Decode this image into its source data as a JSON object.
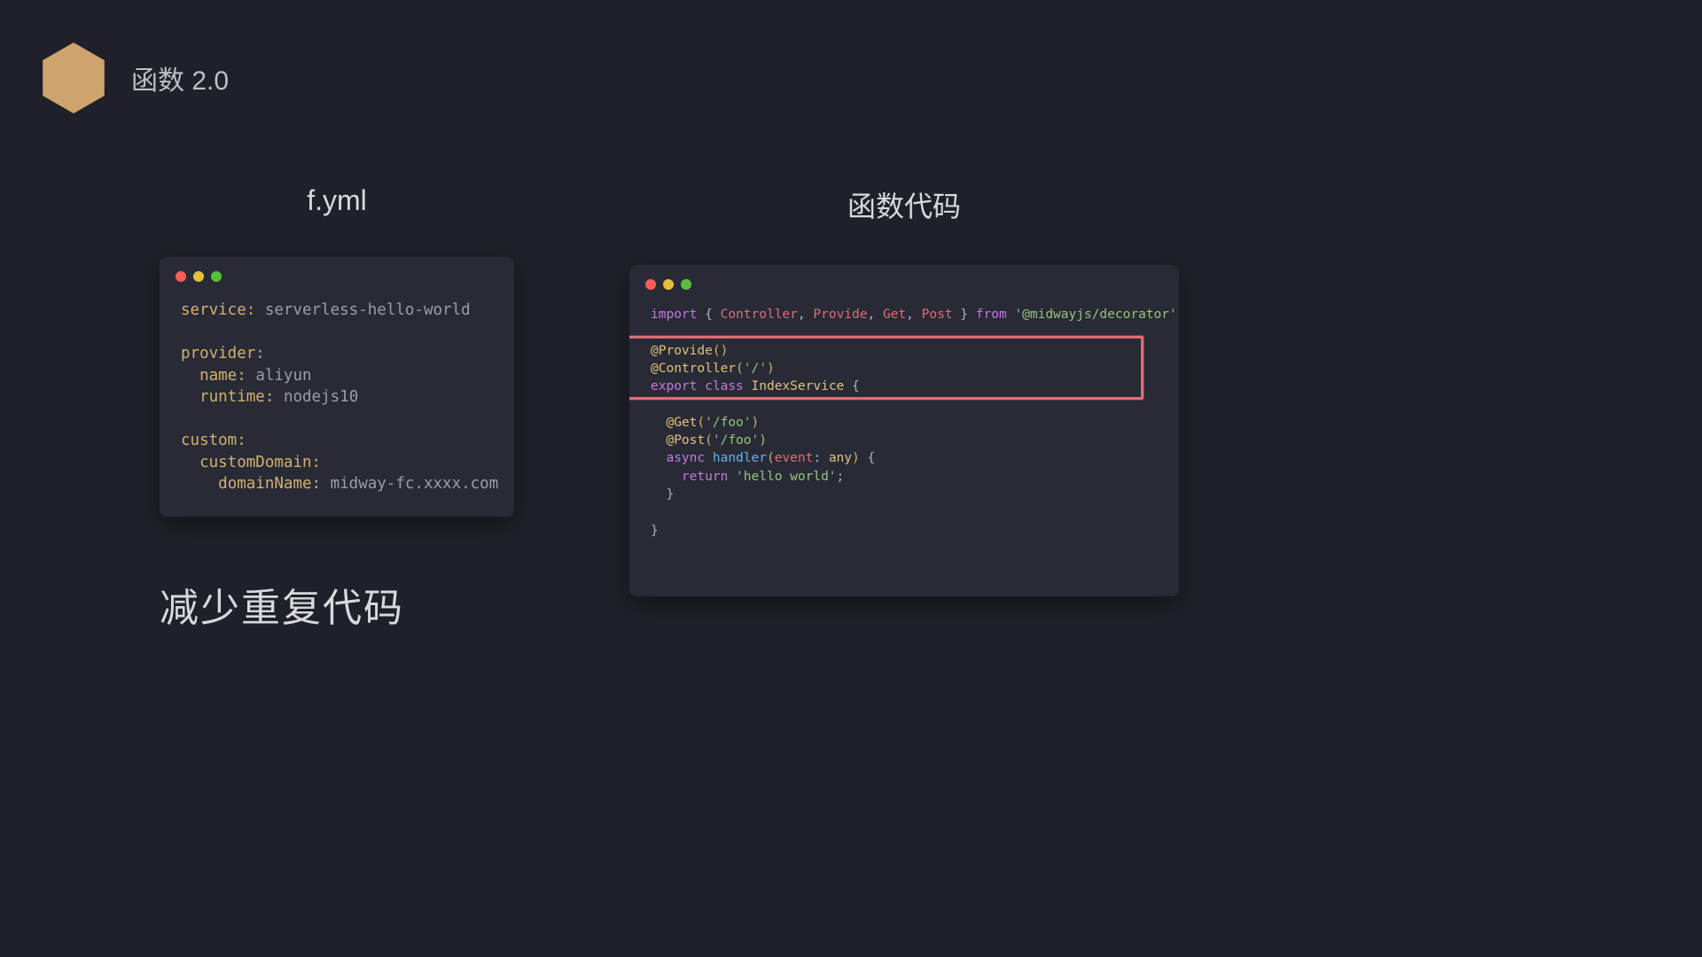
{
  "header": {
    "title": "函数 2.0"
  },
  "columns": {
    "left": {
      "title": "f.yml",
      "code": {
        "line1_key": "service",
        "line1_val": "serverless-hello-world",
        "line2_key": "provider",
        "line3_key": "name",
        "line3_val": "aliyun",
        "line4_key": "runtime",
        "line4_val": "nodejs10",
        "line5_key": "custom",
        "line6_key": "customDomain",
        "line7_key": "domainName",
        "line7_val": "midway-fc.xxxx.com"
      }
    },
    "right": {
      "title": "函数代码",
      "code": {
        "import_kw": "import",
        "import_names": [
          "Controller",
          "Provide",
          "Get",
          "Post"
        ],
        "from_kw": "from",
        "from_module": "'@midwayjs/decorator'",
        "dec_provide": "@Provide",
        "dec_controller": "@Controller",
        "dec_controller_arg": "'/'",
        "export_kw": "export",
        "class_kw": "class",
        "class_name": "IndexService",
        "dec_get": "@Get",
        "dec_get_arg": "'/foo'",
        "dec_post": "@Post",
        "dec_post_arg": "'/foo'",
        "async_kw": "async",
        "handler_name": "handler",
        "param_name": "event",
        "param_type": "any",
        "return_kw": "return",
        "return_val": "'hello world'"
      }
    }
  },
  "bottom": {
    "text": "减少重复代码"
  },
  "colors": {
    "background": "#1f2029",
    "code_bg": "#282b36",
    "accent": "#cea46c",
    "highlight": "#e06c75"
  }
}
